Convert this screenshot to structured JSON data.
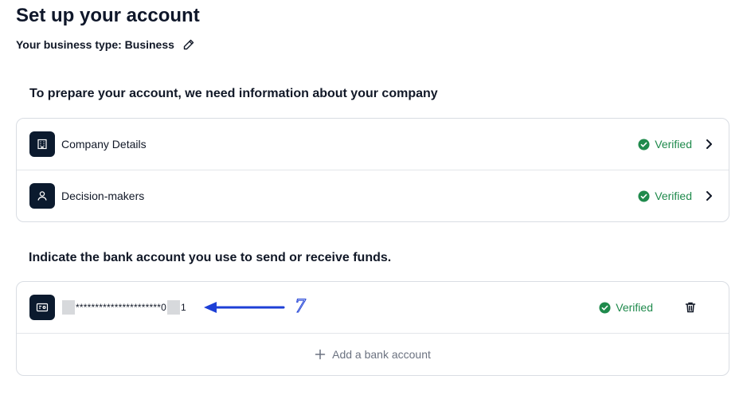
{
  "page": {
    "title": "Set up your account",
    "business_type_label": "Your business type: Business"
  },
  "company_section": {
    "heading": "To prepare your account, we need information about your company",
    "rows": [
      {
        "label": "Company Details",
        "status": "Verified",
        "icon": "building-icon"
      },
      {
        "label": "Decision-makers",
        "status": "Verified",
        "icon": "person-icon"
      }
    ]
  },
  "bank_section": {
    "heading": "Indicate the bank account you use to send or receive funds.",
    "account": {
      "mask_middle": "**********************0",
      "mask_end": "1",
      "status": "Verified",
      "icon": "bank-card-icon"
    },
    "add_label": "Add a bank account"
  },
  "annotation": {
    "number": "7",
    "color": "#1d3fd6"
  },
  "colors": {
    "verified": "#1f8a4c",
    "tile": "#0b1a2e",
    "border": "#d9dde3"
  }
}
